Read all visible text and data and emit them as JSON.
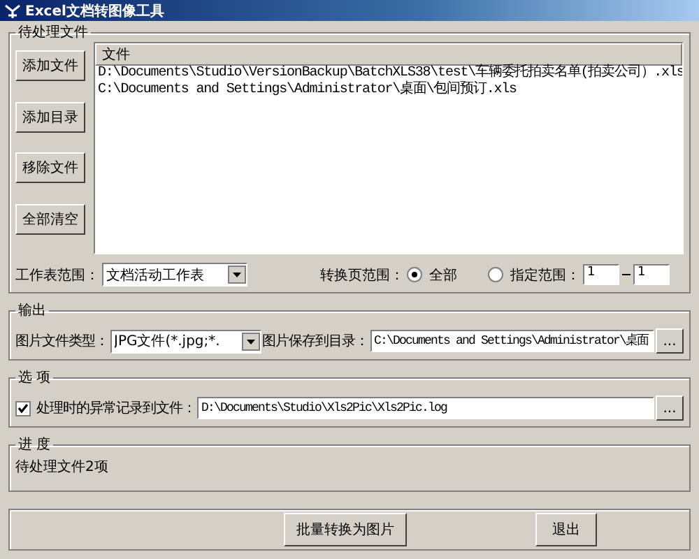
{
  "window": {
    "title": "Excel文档转图像工具"
  },
  "pending_files": {
    "title": "待处理文件",
    "buttons": [
      "添加文件",
      "添加目录",
      "移除文件",
      "全部清空"
    ],
    "list": {
      "column": "文件",
      "rows": [
        "D:\\Documents\\Studio\\VersionBackup\\BatchXLS38\\test\\车辆委托拍卖名单(拍卖公司）.xls",
        "C:\\Documents and Settings\\Administrator\\桌面\\包间预订.xls"
      ]
    },
    "sheet_range": {
      "label": "工作表范围：",
      "value": "文档活动工作表"
    },
    "page_range": {
      "label": "转换页范围：",
      "options": [
        {
          "label": "全部",
          "selected": true
        },
        {
          "label": "指定范围：",
          "selected": false
        }
      ],
      "from": "1",
      "to": "1"
    }
  },
  "output": {
    "title": "输出",
    "type_label": "图片文件类型：",
    "type_value": "JPG文件(*.jpg;*.",
    "dir_label": "图片保存到目录：",
    "dir_value": "C:\\Documents and Settings\\Administrator\\桌面",
    "browse": "..."
  },
  "options": {
    "title": "选 项",
    "log": {
      "label": "处理时的异常记录到文件：",
      "checked": true,
      "value": "D:\\Documents\\Studio\\Xls2Pic\\Xls2Pic.log",
      "browse": "..."
    }
  },
  "progress": {
    "title": "进 度",
    "status": "待处理文件2项"
  },
  "buttons": [
    "批量转换为图片",
    "退出"
  ]
}
